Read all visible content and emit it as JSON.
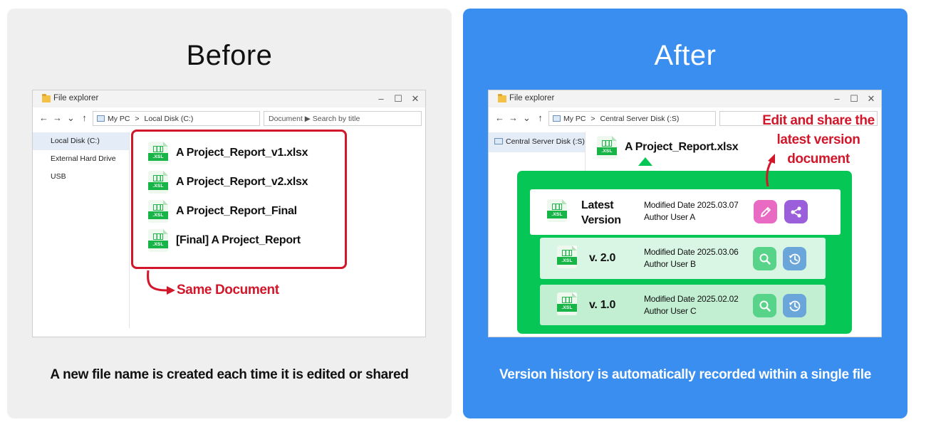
{
  "before": {
    "title": "Before",
    "caption": "A new file name is created each time it is edited or shared",
    "window": {
      "title": "File explorer",
      "path_root": "My PC",
      "path_separator": ">",
      "path_location": "Local Disk (C:)",
      "search_text": "Document ▶ Search by title",
      "sidebar": [
        "Local Disk (C:)",
        "External Hard Drive",
        "USB"
      ]
    },
    "files": [
      "A Project_Report_v1.xlsx",
      "A Project_Report_v2.xlsx",
      "A Project_Report_Final",
      "[Final] A Project_Report"
    ],
    "icon_tag": ".XSL",
    "annotation": "Same Document"
  },
  "after": {
    "title": "After",
    "caption": "Version history is automatically recorded within a single file",
    "window": {
      "title": "File explorer",
      "path_root": "My PC",
      "path_separator": ">",
      "path_location": "Central Server Disk (:S)",
      "sidebar": [
        "Central Server Disk (:S)"
      ]
    },
    "file_name": "A Project_Report.xlsx",
    "icon_tag": ".XSL",
    "callout": [
      "Edit and share the",
      "latest version",
      "document"
    ],
    "versions": [
      {
        "label_line1": "Latest",
        "label_line2": "Version",
        "modified": "Modified Date 2025.03.07",
        "author": "Author User A",
        "actions": [
          "pencil-icon",
          "share-icon"
        ]
      },
      {
        "label_line1": "v. 2.0",
        "modified": "Modified Date 2025.03.06",
        "author": "Author User B",
        "actions": [
          "magnifier-icon",
          "history-icon"
        ]
      },
      {
        "label_line1": "v. 1.0",
        "modified": "Modified Date 2025.02.02",
        "author": "Author User C",
        "actions": [
          "magnifier-icon",
          "history-icon"
        ]
      }
    ]
  },
  "colors": {
    "before_bg": "#efefef",
    "after_bg": "#3a8ef0",
    "accent_red": "#d3172b",
    "version_panel_green": "#06c755",
    "edit_pink": "#e86ac3",
    "share_purple": "#9b5fdc",
    "search_green": "#58d38a",
    "history_blue": "#6aa6d9",
    "excel_green": "#17b548"
  },
  "window_controls": [
    "minimize-icon",
    "maximize-icon",
    "close-icon"
  ],
  "nav_icons": [
    "back-arrow-icon",
    "forward-arrow-icon",
    "chevron-down-icon",
    "up-arrow-icon"
  ]
}
